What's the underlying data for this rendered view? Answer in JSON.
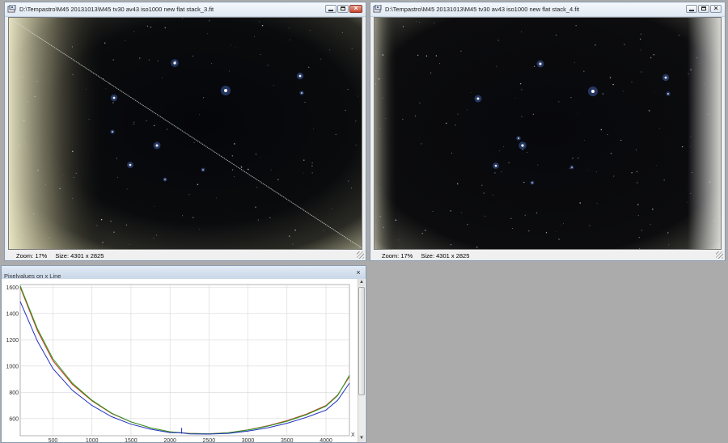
{
  "window_left": {
    "title": "D:\\Tempastro\\M45 20131013\\M45 tv30 av43 iso1000 new flat stack_3.fit",
    "zoom": "Zoom: 17%",
    "size": "Size: 4301 x 2825"
  },
  "window_right": {
    "title": "D:\\Tempastro\\M45 20131013\\M45 tv30 av43 iso1000 new flat stack_4.fit",
    "zoom": "Zoom: 17%",
    "size": "Size: 4301 x 2825"
  },
  "graph_panel": {
    "title": "Pixelvalues on x Line",
    "close_glyph": "×"
  },
  "colors": {
    "titlebar_accent": "#dfe8f2",
    "series_red": "#d03020",
    "series_green": "#20a020",
    "series_blue": "#2030c0",
    "sky": "#06070b",
    "vignette": "#e8e6c8"
  },
  "icons": {
    "app": "fits-image-icon",
    "minimize": "minimize-icon",
    "maximize": "maximize-icon",
    "close": "close-icon"
  },
  "chart_data": {
    "type": "line",
    "x_ticks": [
      500,
      1000,
      1500,
      2000,
      2500,
      3000,
      3500,
      4000
    ],
    "y_ticks": [
      600,
      800,
      1000,
      1200,
      1400,
      1600
    ],
    "xlabel": "X",
    "xlim": [
      80,
      4301
    ],
    "ylim": [
      470,
      1620
    ],
    "grid": true,
    "series": [
      {
        "color": "red",
        "points": [
          [
            80,
            1600
          ],
          [
            300,
            1270
          ],
          [
            500,
            1040
          ],
          [
            750,
            860
          ],
          [
            1000,
            735
          ],
          [
            1250,
            640
          ],
          [
            1500,
            575
          ],
          [
            1750,
            530
          ],
          [
            2000,
            500
          ],
          [
            2250,
            488
          ],
          [
            2500,
            485
          ],
          [
            2750,
            493
          ],
          [
            3000,
            515
          ],
          [
            3250,
            545
          ],
          [
            3500,
            585
          ],
          [
            3750,
            635
          ],
          [
            4000,
            700
          ],
          [
            4150,
            780
          ],
          [
            4301,
            920
          ]
        ]
      },
      {
        "color": "green",
        "points": [
          [
            80,
            1610
          ],
          [
            300,
            1285
          ],
          [
            500,
            1055
          ],
          [
            750,
            870
          ],
          [
            1000,
            740
          ],
          [
            1250,
            643
          ],
          [
            1500,
            576
          ],
          [
            1750,
            530
          ],
          [
            2000,
            499
          ],
          [
            2250,
            487
          ],
          [
            2500,
            484
          ],
          [
            2750,
            492
          ],
          [
            3000,
            513
          ],
          [
            3250,
            542
          ],
          [
            3500,
            580
          ],
          [
            3750,
            630
          ],
          [
            4000,
            695
          ],
          [
            4150,
            775
          ],
          [
            4301,
            930
          ]
        ]
      },
      {
        "color": "blue",
        "points": [
          [
            80,
            1490
          ],
          [
            300,
            1190
          ],
          [
            500,
            980
          ],
          [
            750,
            815
          ],
          [
            1000,
            700
          ],
          [
            1250,
            615
          ],
          [
            1500,
            558
          ],
          [
            1750,
            520
          ],
          [
            2000,
            494
          ],
          [
            2150,
            492
          ],
          [
            2250,
            484
          ],
          [
            2500,
            482
          ],
          [
            2750,
            488
          ],
          [
            3000,
            505
          ],
          [
            3250,
            530
          ],
          [
            3500,
            565
          ],
          [
            3750,
            610
          ],
          [
            4000,
            665
          ],
          [
            4150,
            740
          ],
          [
            4301,
            870
          ]
        ]
      }
    ],
    "spike": {
      "x": 2150,
      "y": 530
    }
  }
}
